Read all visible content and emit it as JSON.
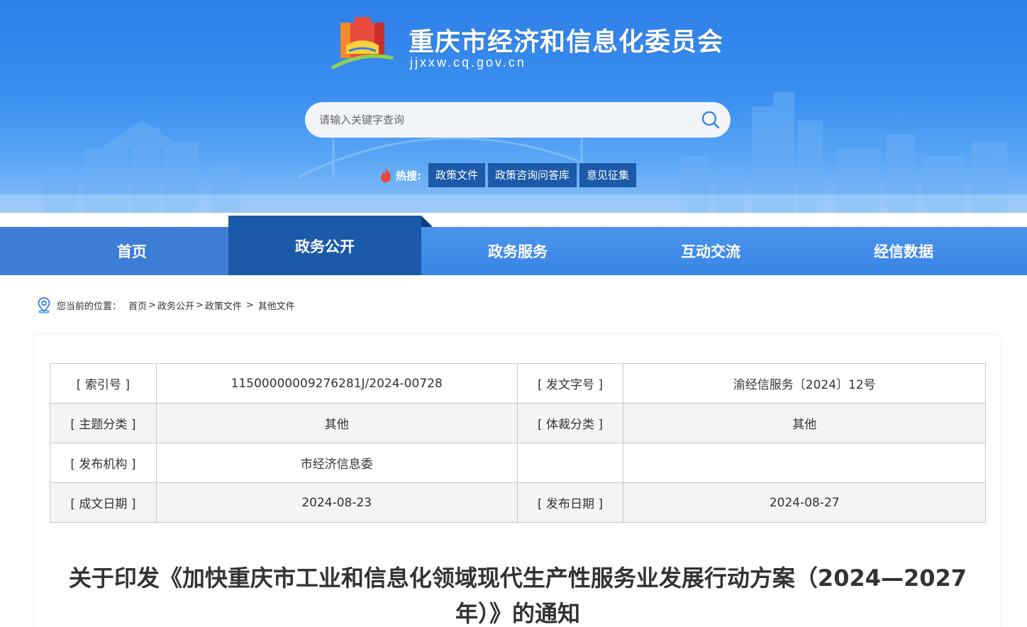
{
  "header": {
    "site_title": "重庆市经济和信息化委员会",
    "site_domain": "jjxxw.cq.gov.cn",
    "search_placeholder": "请输入关键字查询",
    "hot_label": "热搜:",
    "hot_tags": [
      "政策文件",
      "政策咨询问答库",
      "意见征集"
    ]
  },
  "nav": {
    "items": [
      "首页",
      "政务公开",
      "政务服务",
      "互动交流",
      "经信数据"
    ],
    "active_index": 1
  },
  "breadcrumb": {
    "prefix": "您当前的位置：",
    "path": [
      "首页",
      "政务公开",
      "政策文件",
      "其他文件"
    ]
  },
  "meta": {
    "rows": [
      {
        "label1": "[ 索引号 ]",
        "value1": "11500000009276281J/2024-00728",
        "label2": "[ 发文字号 ]",
        "value2": "渝经信服务〔2024〕12号"
      },
      {
        "label1": "[ 主题分类 ]",
        "value1": "其他",
        "label2": "[ 体裁分类 ]",
        "value2": "其他"
      },
      {
        "label1": "[ 发布机构 ]",
        "value1": "市经济信息委",
        "label2": "",
        "value2": ""
      },
      {
        "label1": "[ 成文日期 ]",
        "value1": "2024-08-23",
        "label2": "[ 发布日期 ]",
        "value2": "2024-08-27"
      }
    ]
  },
  "document": {
    "title": "关于印发《加快重庆市工业和信息化领域现代生产性服务业发展行动方案（2024—2027年）》的通知"
  },
  "colors": {
    "banner_blue": "#2f7fe8",
    "nav_active": "#1a5aa8",
    "hot_tag_bg": "#1a5aa8"
  }
}
